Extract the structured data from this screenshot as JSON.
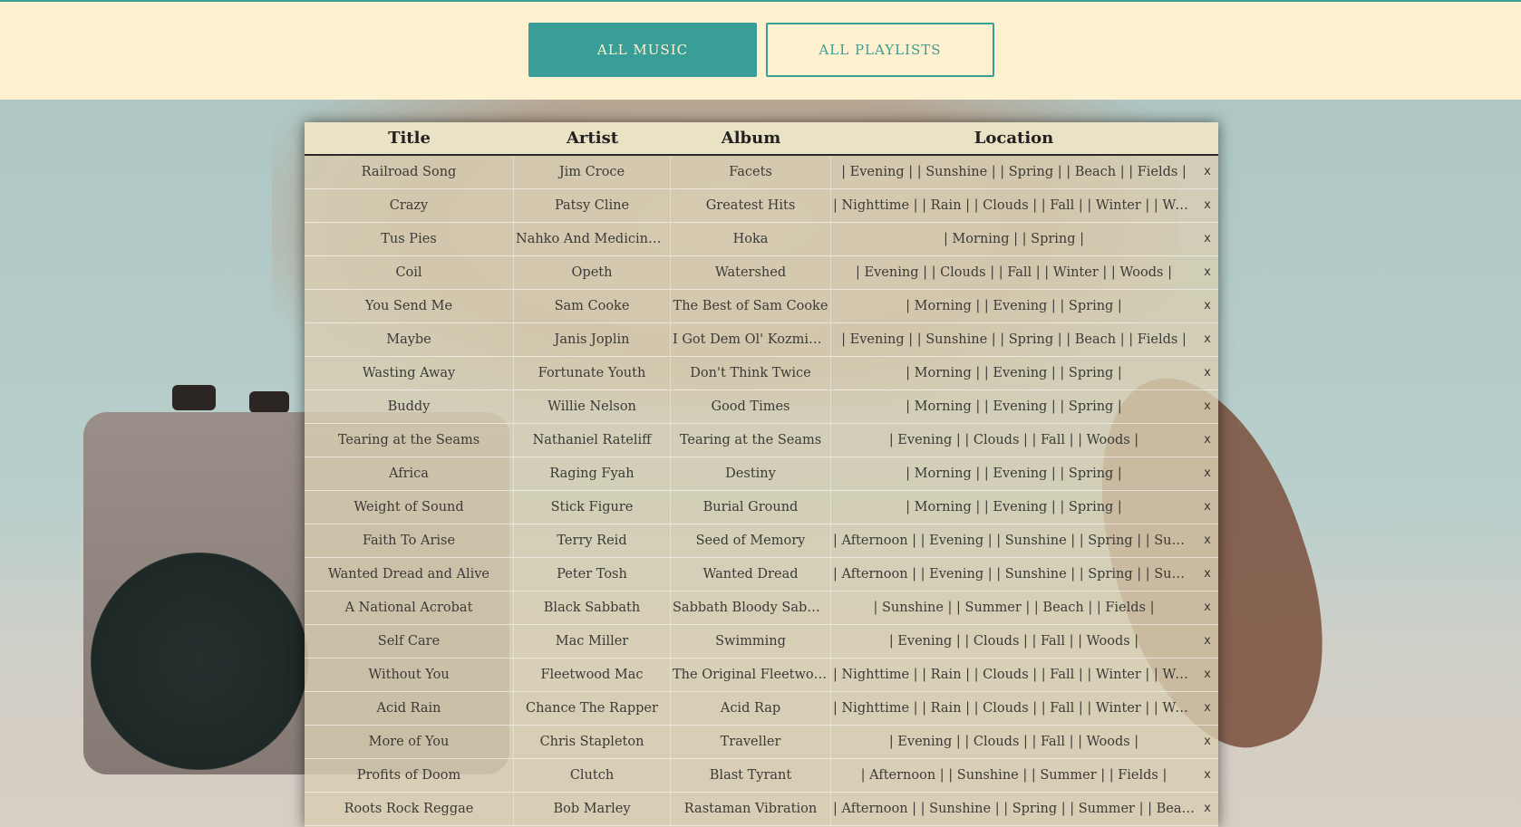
{
  "nav": {
    "all_music": "All Music",
    "all_playlists": "All Playlists"
  },
  "colors": {
    "accent": "#3a9e98",
    "header_bg": "#fdf1cf"
  },
  "table": {
    "headers": {
      "title": "Title",
      "artist": "Artist",
      "album": "Album",
      "location": "Location"
    },
    "delete_label": "x",
    "rows": [
      {
        "title": "Railroad Song",
        "artist": "Jim Croce",
        "album": "Facets",
        "location": "| Evening | | Sunshine | | Spring | | Beach | | Fields |"
      },
      {
        "title": "Crazy",
        "artist": "Patsy Cline",
        "album": "Greatest Hits",
        "location": "| Nighttime | | Rain | | Clouds | | Fall | | Winter | | Woods |"
      },
      {
        "title": "Tus Pies",
        "artist": "Nahko And Medicine Fo...",
        "album": "Hoka",
        "location": "| Morning | | Spring |"
      },
      {
        "title": "Coil",
        "artist": "Opeth",
        "album": "Watershed",
        "location": "| Evening | | Clouds | | Fall | | Winter | | Woods |"
      },
      {
        "title": "You Send Me",
        "artist": "Sam Cooke",
        "album": "The Best of Sam Cooke",
        "location": "| Morning | | Evening | | Spring |"
      },
      {
        "title": "Maybe",
        "artist": "Janis Joplin",
        "album": "I Got Dem Ol' Kozmic B...",
        "location": "| Evening | | Sunshine | | Spring | | Beach | | Fields |"
      },
      {
        "title": "Wasting Away",
        "artist": "Fortunate Youth",
        "album": "Don't Think Twice",
        "location": "| Morning | | Evening | | Spring |"
      },
      {
        "title": "Buddy",
        "artist": "Willie Nelson",
        "album": "Good Times",
        "location": "| Morning | | Evening | | Spring |"
      },
      {
        "title": "Tearing at the Seams",
        "artist": "Nathaniel Rateliff",
        "album": "Tearing at the Seams",
        "location": "| Evening | | Clouds | | Fall | | Woods |"
      },
      {
        "title": "Africa",
        "artist": "Raging Fyah",
        "album": "Destiny",
        "location": "| Morning | | Evening | | Spring |"
      },
      {
        "title": "Weight of Sound",
        "artist": "Stick Figure",
        "album": "Burial Ground",
        "location": "| Morning | | Evening | | Spring |"
      },
      {
        "title": "Faith To Arise",
        "artist": "Terry Reid",
        "album": "Seed of Memory",
        "location": "| Afternoon | | Evening | | Sunshine | | Spring | | Summer | | Be..."
      },
      {
        "title": "Wanted Dread and Alive",
        "artist": "Peter Tosh",
        "album": "Wanted Dread",
        "location": "| Afternoon | | Evening | | Sunshine | | Spring | | Summer | | Be..."
      },
      {
        "title": "A National Acrobat",
        "artist": "Black Sabbath",
        "album": "Sabbath Bloody Sabbath",
        "location": "| Sunshine | | Summer | | Beach | | Fields |"
      },
      {
        "title": "Self Care",
        "artist": "Mac Miller",
        "album": "Swimming",
        "location": "| Evening | | Clouds | | Fall | | Woods |"
      },
      {
        "title": "Without You",
        "artist": "Fleetwood Mac",
        "album": "The Original Fleetwood ...",
        "location": "| Nighttime | | Rain | | Clouds | | Fall | | Winter | | Woods |"
      },
      {
        "title": "Acid Rain",
        "artist": "Chance The Rapper",
        "album": "Acid Rap",
        "location": "| Nighttime | | Rain | | Clouds | | Fall | | Winter | | Woods |"
      },
      {
        "title": "More of You",
        "artist": "Chris Stapleton",
        "album": "Traveller",
        "location": "| Evening | | Clouds | | Fall | | Woods |"
      },
      {
        "title": "Profits of Doom",
        "artist": "Clutch",
        "album": "Blast Tyrant",
        "location": "| Afternoon | | Sunshine | | Summer | | Fields |"
      },
      {
        "title": "Roots Rock Reggae",
        "artist": "Bob Marley",
        "album": "Rastaman Vibration",
        "location": "| Afternoon | | Sunshine | | Spring | | Summer | | Beach | | Field..."
      }
    ]
  }
}
